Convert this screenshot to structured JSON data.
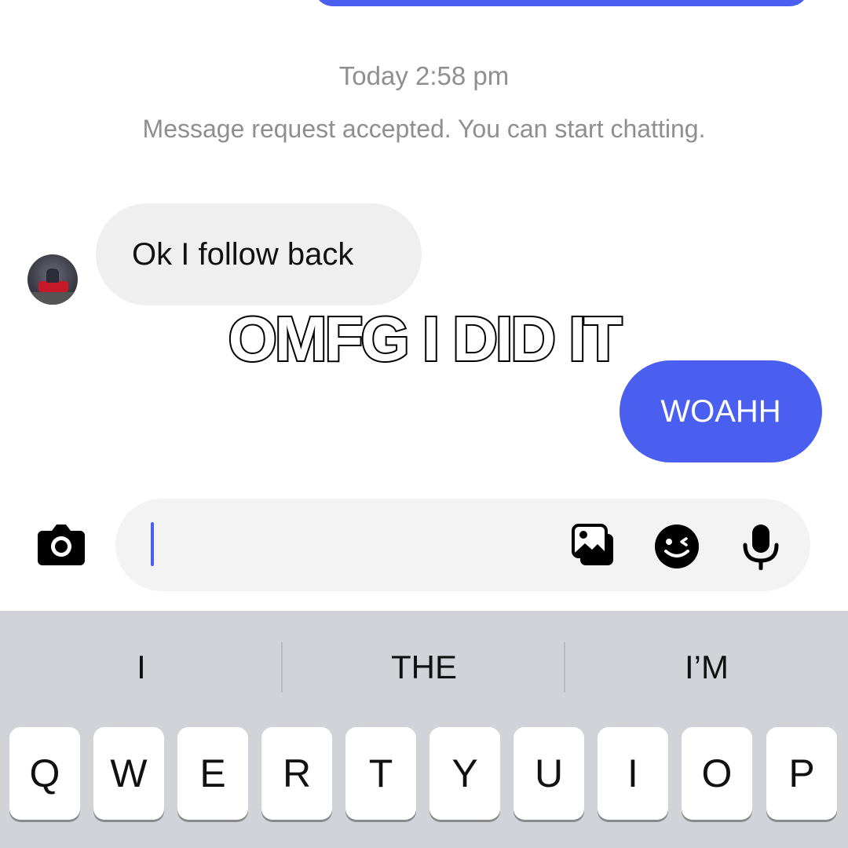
{
  "chat": {
    "timestamp": "Today 2:58 pm",
    "system_message": "Message request accepted. You can start chatting.",
    "incoming_message": "Ok I follow back",
    "outgoing_message": "WOAHH",
    "overlay_caption": "OMFG I DID IT"
  },
  "composer": {
    "input_value": "",
    "icons": [
      "camera-icon",
      "gallery-icon",
      "sticker-icon",
      "microphone-icon"
    ]
  },
  "keyboard": {
    "suggestions": [
      "I",
      "THE",
      "I’M"
    ],
    "row1": [
      "Q",
      "W",
      "E",
      "R",
      "T",
      "Y",
      "U",
      "I",
      "O",
      "P"
    ]
  },
  "colors": {
    "accent": "#4a5ff0",
    "incoming_bubble": "#efefef",
    "keyboard_bg": "#d1d3d9"
  }
}
